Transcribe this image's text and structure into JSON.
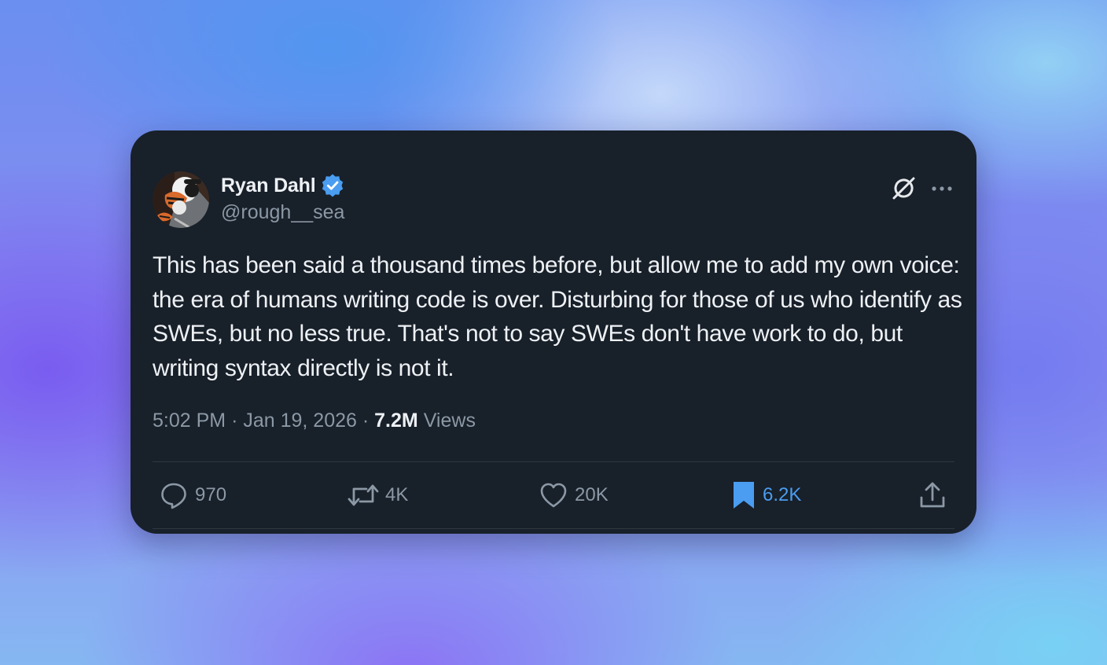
{
  "author": {
    "name": "Ryan Dahl",
    "handle": "@rough__sea",
    "verified": true
  },
  "tweet": {
    "text": "This has been said a thousand times before, but allow me to add my own voice: the era of humans writing code is over. Disturbing for those of us who identify as SWEs, but no less true. That's not to say SWEs don't have work to do, but writing syntax directly is not it.",
    "time": "5:02 PM",
    "separator": "·",
    "date": "Jan 19, 2026",
    "views_count": "7.2M",
    "views_label": "Views"
  },
  "actions": {
    "replies": "970",
    "reposts": "4K",
    "likes": "20K",
    "bookmarks": "6.2K",
    "bookmarked": true
  },
  "colors": {
    "card_background": "#18202a",
    "text_primary": "#eef1f4",
    "text_secondary": "#8b98a5",
    "verified_badge": "#4a9df0",
    "bookmark_active": "#4a9df0",
    "divider": "#2f3840"
  },
  "icons": {
    "verified": "verified-badge-icon",
    "grok": "grok-icon",
    "more": "more-options-icon",
    "reply": "reply-icon",
    "repost": "repost-icon",
    "like": "heart-icon",
    "bookmark": "bookmark-icon",
    "share": "share-icon"
  }
}
